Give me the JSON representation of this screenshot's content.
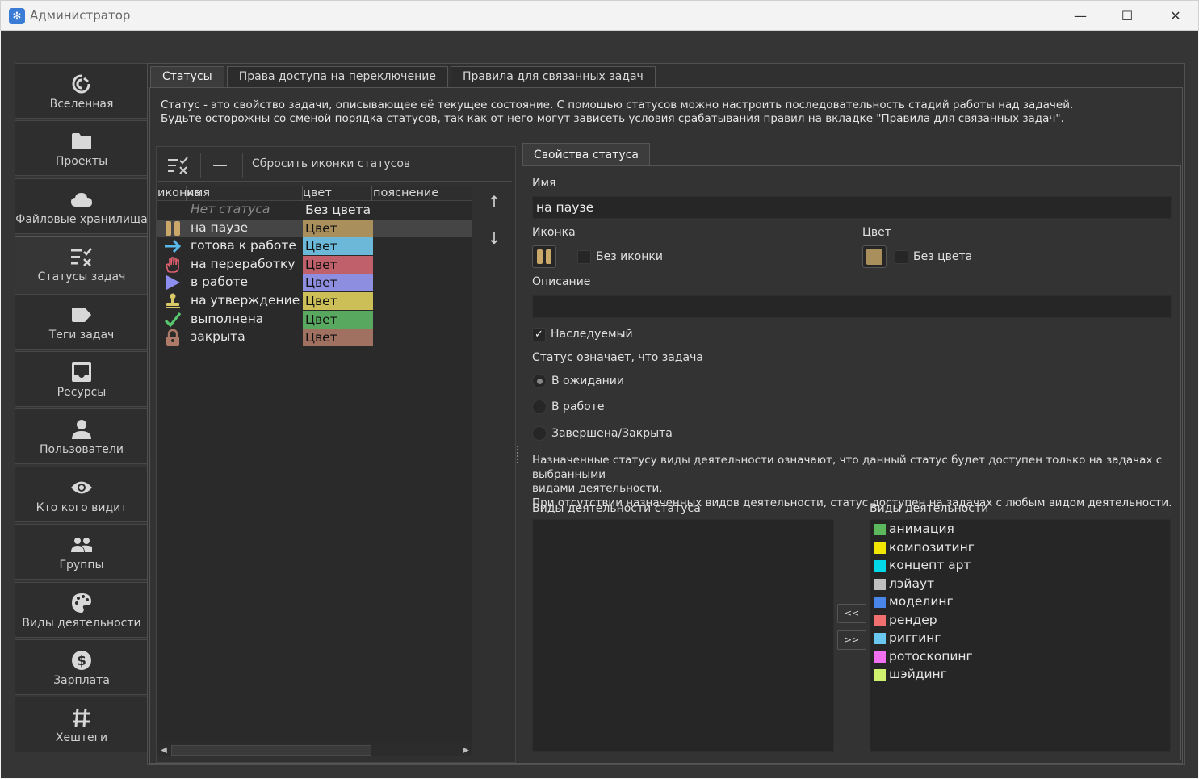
{
  "window": {
    "title": "Администратор",
    "app_icon": "snowflake-icon",
    "controls": [
      "minimize-icon",
      "maximize-icon",
      "close-icon"
    ]
  },
  "sidebar": {
    "items": [
      {
        "label": "Вселенная",
        "icon": "spiral-icon"
      },
      {
        "label": "Проекты",
        "icon": "folder-icon"
      },
      {
        "label": "Файловые хранилища",
        "icon": "cloud-icon"
      },
      {
        "label": "Статусы задач",
        "icon": "status-list-icon",
        "active": true
      },
      {
        "label": "Теги задач",
        "icon": "tag-icon"
      },
      {
        "label": "Ресурсы",
        "icon": "inbox-icon"
      },
      {
        "label": "Пользователи",
        "icon": "user-icon"
      },
      {
        "label": "Кто кого видит",
        "icon": "eye-icon"
      },
      {
        "label": "Группы",
        "icon": "group-icon"
      },
      {
        "label": "Виды деятельности",
        "icon": "palette-icon"
      },
      {
        "label": "Зарплата",
        "icon": "dollar-icon"
      },
      {
        "label": "Хештеги",
        "icon": "hashtag-icon"
      }
    ]
  },
  "tabs": [
    {
      "label": "Статусы",
      "active": true
    },
    {
      "label": "Права доступа на переключение"
    },
    {
      "label": "Правила для связанных задач"
    }
  ],
  "description": {
    "line1": "Статус - это свойство задачи, описывающее её текущее состояние. С помощью статусов можно настроить последовательность стадий работы над задачей.",
    "line2": "Будьте осторожны со сменой порядка статусов, так как от него могут зависеть условия срабатывания правил на вкладке \"Правила для связанных задач\"."
  },
  "toolbar": {
    "reset_icons_label": "Сбросить иконки статусов"
  },
  "table": {
    "headers": {
      "icon": "иконка",
      "name": "имя",
      "color": "цвет",
      "note": "пояснение"
    },
    "rows": [
      {
        "icon": "",
        "name": "Нет статуса",
        "color_label": "Без цвета",
        "color": "",
        "muted": true
      },
      {
        "icon": "pause-icon",
        "name": "на паузе",
        "color_label": "Цвет",
        "color": "#a88f5c",
        "selected": true
      },
      {
        "icon": "arrow-right-icon",
        "name": "готова к работе",
        "color_label": "Цвет",
        "color": "#6cb8d8"
      },
      {
        "icon": "hand-icon",
        "name": "на переработку",
        "color_label": "Цвет",
        "color": "#c0606a"
      },
      {
        "icon": "play-icon",
        "name": "в работе",
        "color_label": "Цвет",
        "color": "#8e8ee0"
      },
      {
        "icon": "stamp-icon",
        "name": "на утверждение",
        "color_label": "Цвет",
        "color": "#cdbf58"
      },
      {
        "icon": "check-icon",
        "name": "выполнена",
        "color_label": "Цвет",
        "color": "#58a860"
      },
      {
        "icon": "lock-icon",
        "name": "закрыта",
        "color_label": "Цвет",
        "color": "#a07060"
      }
    ]
  },
  "properties": {
    "tab_label": "Свойства статуса",
    "name_label": "Имя",
    "name_value": "на паузе",
    "icon_label": "Иконка",
    "no_icon_label": "Без иконки",
    "color_label": "Цвет",
    "color_value": "#a88f5c",
    "no_color_label": "Без цвета",
    "description_label": "Описание",
    "description_value": "",
    "inherited_label": "Наследуемый",
    "inherited_checked": true,
    "meaning_label": "Статус означает, что задача",
    "meaning_options": [
      "В ожидании",
      "В работе",
      "Завершена/Закрыта"
    ],
    "meaning_selected": "В ожидании",
    "activity_info_1": "Назначенные статусу виды деятельности означают, что данный статус будет доступен только на задачах с выбранными",
    "activity_info_2": "видами деятельности.",
    "activity_info_3": "При отсутствии назначенных видов деятельности, статус доступен на задачах с любым видом деятельности.",
    "status_activities_label": "Виды деятельности статуса",
    "all_activities_label": "Виды деятельности",
    "move_left_label": "<<",
    "move_right_label": ">>",
    "activities": [
      {
        "name": "анимация",
        "color": "#5cb85c"
      },
      {
        "name": "композитинг",
        "color": "#f2e600"
      },
      {
        "name": "концепт арт",
        "color": "#00d8e8"
      },
      {
        "name": "лэйаут",
        "color": "#c0c0c0"
      },
      {
        "name": "моделинг",
        "color": "#4a86e8"
      },
      {
        "name": "рендер",
        "color": "#f07070"
      },
      {
        "name": "риггинг",
        "color": "#6ac8f0"
      },
      {
        "name": "ротоскопинг",
        "color": "#f070f0"
      },
      {
        "name": "шэйдинг",
        "color": "#d0f070"
      }
    ]
  }
}
